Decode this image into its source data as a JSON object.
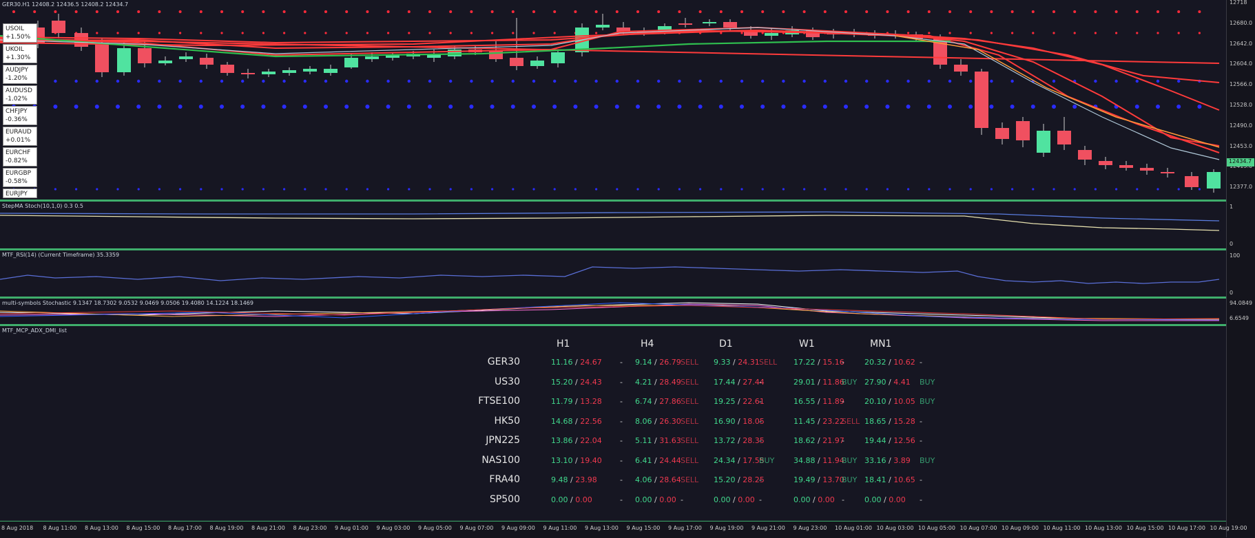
{
  "main_chart": {
    "title": "GER30.H1  12408.2 12436.5 12408.2 12434.7",
    "current_price": "12434.7",
    "price_axis": [
      "12718",
      "12680.0",
      "12642.0",
      "12604.0",
      "12566.0",
      "12528.0",
      "12490.0",
      "12453.0",
      "12415.0",
      "12377.0"
    ],
    "colors": {
      "bull": "#50e3a0",
      "bear": "#f05060",
      "ma_red": "#ff3b3b",
      "ma_green": "#2fbf4f",
      "dots_red": "#ff2a3a",
      "dots_blue": "#2a2cff",
      "separator": "#3fae6c"
    }
  },
  "symbols": [
    {
      "name": "USOIL",
      "change": "+1.50%"
    },
    {
      "name": "UKOIL",
      "change": "+1.30%"
    },
    {
      "name": "AUDJPY",
      "change": "-1.20%"
    },
    {
      "name": "AUDUSD",
      "change": "-1.02%"
    },
    {
      "name": "CHFJPY",
      "change": "-0.36%"
    },
    {
      "name": "EURAUD",
      "change": "+0.01%"
    },
    {
      "name": "EURCHF",
      "change": "-0.82%"
    },
    {
      "name": "EURGBP",
      "change": "-0.58%"
    },
    {
      "name": "EURJPY",
      "change": ""
    }
  ],
  "indicators": [
    {
      "label": "StepMA Stoch(10,1,0) 0.3 0.5",
      "axis_top": "1",
      "axis_bottom": "0"
    },
    {
      "label": "MTF_RSI(14) (Current Timeframe) 35.3359",
      "axis_top": "100",
      "axis_bottom": "0"
    },
    {
      "label": "multi-symbols Stochastic 9.1347 18.7302 9.0532 9.0469 9.0506 19.4080 14.1224 18.1469",
      "axis_top": "94.0849",
      "axis_bottom": "6.6549"
    },
    {
      "label": "MTF_MCP_ADX_DMI_list"
    }
  ],
  "dashboard": {
    "timeframes": [
      "H1",
      "H4",
      "D1",
      "W1",
      "MN1"
    ],
    "rows": [
      {
        "symbol": "GER30",
        "cells": [
          {
            "v": "11.16 / 24.67",
            "sig": "-"
          },
          {
            "v": "9.14 / 26.79",
            "sig": "SELL"
          },
          {
            "v": "9.33 / 24.31",
            "sig": "SELL"
          },
          {
            "v": "17.22 / 15.16",
            "sig": "-"
          },
          {
            "v": "20.32 / 10.62",
            "sig": "-"
          }
        ]
      },
      {
        "symbol": "US30",
        "cells": [
          {
            "v": "15.20 / 24.43",
            "sig": "-"
          },
          {
            "v": "4.21 / 28.49",
            "sig": "SELL"
          },
          {
            "v": "17.44 / 27.44",
            "sig": "-"
          },
          {
            "v": "29.01 / 11.86",
            "sig": "BUY"
          },
          {
            "v": "27.90 / 4.41",
            "sig": "BUY"
          }
        ]
      },
      {
        "symbol": "FTSE100",
        "cells": [
          {
            "v": "11.79 / 13.28",
            "sig": "-"
          },
          {
            "v": "6.74 / 27.86",
            "sig": "SELL"
          },
          {
            "v": "19.25 / 22.61",
            "sig": "-"
          },
          {
            "v": "16.55 / 11.89",
            "sig": "-"
          },
          {
            "v": "20.10 / 10.05",
            "sig": "BUY"
          }
        ]
      },
      {
        "symbol": "HK50",
        "cells": [
          {
            "v": "14.68 / 22.56",
            "sig": "-"
          },
          {
            "v": "8.06 / 26.30",
            "sig": "SELL"
          },
          {
            "v": "16.90 / 18.05",
            "sig": "-"
          },
          {
            "v": "11.45 / 23.22",
            "sig": "SELL"
          },
          {
            "v": "18.65 / 15.28",
            "sig": "-"
          }
        ]
      },
      {
        "symbol": "JPN225",
        "cells": [
          {
            "v": "13.86 / 22.04",
            "sig": "-"
          },
          {
            "v": "5.11 / 31.63",
            "sig": "SELL"
          },
          {
            "v": "13.72 / 28.35",
            "sig": "-"
          },
          {
            "v": "18.62 / 21.97",
            "sig": "-"
          },
          {
            "v": "19.44 / 12.56",
            "sig": "-"
          }
        ]
      },
      {
        "symbol": "NAS100",
        "cells": [
          {
            "v": "13.10 / 19.40",
            "sig": "-"
          },
          {
            "v": "6.41 / 24.44",
            "sig": "SELL"
          },
          {
            "v": "24.34 / 17.55",
            "sig": "BUY"
          },
          {
            "v": "34.88 / 11.94",
            "sig": "BUY"
          },
          {
            "v": "33.16 / 3.89",
            "sig": "BUY"
          }
        ]
      },
      {
        "symbol": "FRA40",
        "cells": [
          {
            "v": "9.48 / 23.98",
            "sig": "-"
          },
          {
            "v": "4.06 / 28.64",
            "sig": "SELL"
          },
          {
            "v": "15.20 / 28.25",
            "sig": "-"
          },
          {
            "v": "19.49 / 13.70",
            "sig": "BUY"
          },
          {
            "v": "18.41 / 10.65",
            "sig": "-"
          }
        ]
      },
      {
        "symbol": "SP500",
        "cells": [
          {
            "v": "0.00 / 0.00",
            "sig": "-"
          },
          {
            "v": "0.00 / 0.00",
            "sig": "-"
          },
          {
            "v": "0.00 / 0.00",
            "sig": "-"
          },
          {
            "v": "0.00 / 0.00",
            "sig": "-"
          },
          {
            "v": "0.00 / 0.00",
            "sig": "-"
          }
        ]
      }
    ]
  },
  "time_axis": [
    "8 Aug 2018",
    "8 Aug 11:00",
    "8 Aug 13:00",
    "8 Aug 15:00",
    "8 Aug 17:00",
    "8 Aug 19:00",
    "8 Aug 21:00",
    "8 Aug 23:00",
    "9 Aug 01:00",
    "9 Aug 03:00",
    "9 Aug 05:00",
    "9 Aug 07:00",
    "9 Aug 09:00",
    "9 Aug 11:00",
    "9 Aug 13:00",
    "9 Aug 15:00",
    "9 Aug 17:00",
    "9 Aug 19:00",
    "9 Aug 21:00",
    "9 Aug 23:00",
    "10 Aug 01:00",
    "10 Aug 03:00",
    "10 Aug 05:00",
    "10 Aug 07:00",
    "10 Aug 09:00",
    "10 Aug 11:00",
    "10 Aug 13:00",
    "10 Aug 15:00",
    "10 Aug 17:00",
    "10 Aug 19:00"
  ]
}
